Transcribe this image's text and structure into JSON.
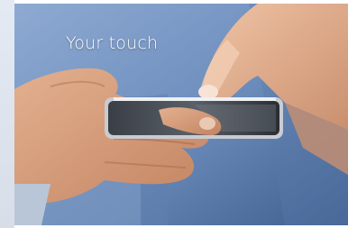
{
  "image": {
    "caption": "Your touch",
    "subject": "hands-holding-smartphone-photo",
    "colors": {
      "shirt": "#6d8ab4",
      "skin": "#d8a684",
      "phone_body": "#2b2f35",
      "phone_frame": "#c8ccd2"
    }
  }
}
